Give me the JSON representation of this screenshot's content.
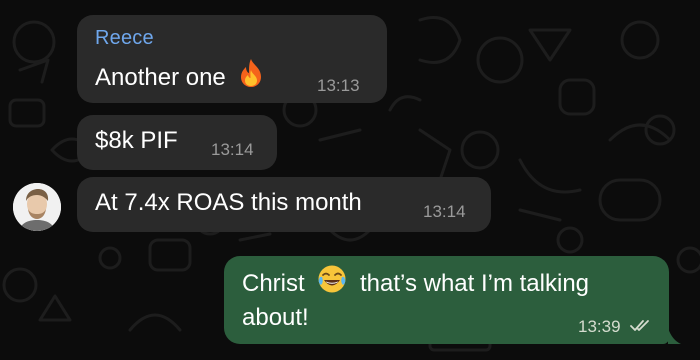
{
  "conversation": {
    "messages": [
      {
        "sender": "Reece",
        "text": "Another one",
        "emoji": "fire-emoji",
        "time": "13:13"
      },
      {
        "text": "$8k PIF",
        "time": "13:14"
      },
      {
        "text": "At 7.4x ROAS this month",
        "time": "13:14"
      }
    ],
    "outgoing": {
      "line1_before": "Christ",
      "emoji": "joy-emoji",
      "line1_after": "that’s what I’m talking",
      "line2": "about!",
      "time": "13:39",
      "status_icon": "double-check-icon"
    }
  },
  "colors": {
    "background": "#0c0c0c",
    "incoming_bubble": "#2a2a2a",
    "outgoing_bubble": "#2c5e3d",
    "sender_name": "#6fa7ec",
    "timestamp": "#9a9a9a"
  }
}
